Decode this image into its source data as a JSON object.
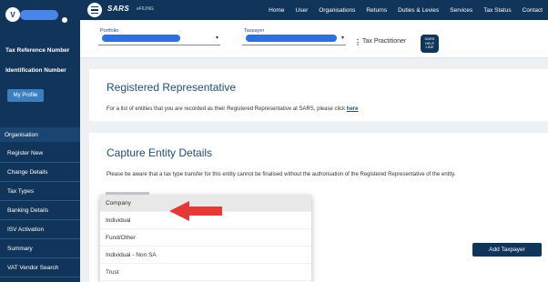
{
  "sidebar": {
    "avatar_initial": "V",
    "tax_ref_label": "Tax Reference Number",
    "id_label": "Identification Number",
    "profile_button": "My Profile",
    "section_label": "Organisation",
    "items": [
      {
        "label": "Register New"
      },
      {
        "label": "Change Details"
      },
      {
        "label": "Tax Types"
      },
      {
        "label": "Banking Details"
      },
      {
        "label": "ISV Activation"
      },
      {
        "label": "Summary"
      },
      {
        "label": "VAT Vendor Search"
      }
    ]
  },
  "topbar": {
    "logo": "SARS",
    "logo_sub": "eFILING",
    "nav": [
      "Home",
      "User",
      "Organisations",
      "Returns",
      "Duties & Levies",
      "Services",
      "Tax Status",
      "Contact"
    ]
  },
  "portfolio": {
    "portfolio_label": "Portfolio",
    "taxpayer_label": "Taxpayer",
    "role": "Tax Practitioner",
    "badge_text": "SARS HELP LINE"
  },
  "registered": {
    "title": "Registered Representative",
    "text": "For a list of entities that you are recorded as their Registered Representative at SARS, please click ",
    "link": "here"
  },
  "capture": {
    "title": "Capture Entity Details",
    "text": "Please be aware that a tax type transfer for this entity cannot be finalised without the authorisation of the Registered Representative of the entity.",
    "add_button": "Add Taxpayer"
  },
  "dropdown": {
    "options": [
      "Company",
      "Individual",
      "Fund/Other",
      "Individual - Non SA",
      "Trust"
    ],
    "selected": "Company"
  },
  "colors": {
    "navy": "#10345a",
    "accent_blue": "#3b7fc0",
    "arrow_red": "#e53935"
  }
}
